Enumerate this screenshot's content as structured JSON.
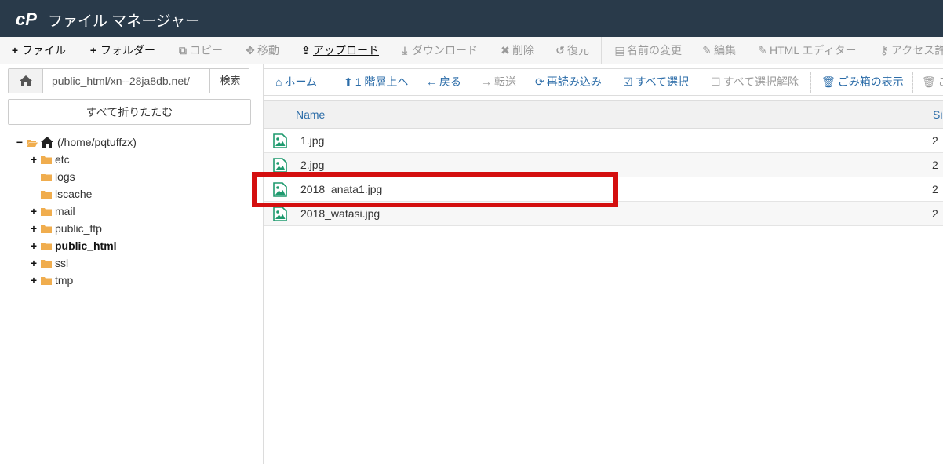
{
  "header": {
    "title": "ファイル マネージャー",
    "logo_icon": "cpanel-logo-icon"
  },
  "toolbar": [
    {
      "icon": "+",
      "label": "ファイル",
      "state": "active"
    },
    {
      "icon": "+",
      "label": "フォルダー",
      "state": "active"
    },
    {
      "icon": "⧉",
      "label": "コピー",
      "state": "disabled"
    },
    {
      "icon": "✥",
      "label": "移動",
      "state": "disabled"
    },
    {
      "icon": "⇪",
      "label": "アップロード",
      "state": "upload"
    },
    {
      "icon": "⤓",
      "label": "ダウンロード",
      "state": "disabled"
    },
    {
      "icon": "✖",
      "label": "削除",
      "state": "disabled"
    },
    {
      "icon": "↺",
      "label": "復元",
      "state": "disabled"
    },
    {
      "icon": "▤",
      "label": "名前の変更",
      "state": "disabled"
    },
    {
      "icon": "✎",
      "label": "編集",
      "state": "disabled"
    },
    {
      "icon": "✎",
      "label": "HTML エディター",
      "state": "disabled"
    },
    {
      "icon": "⚷",
      "label": "アクセス許",
      "state": "disabled"
    }
  ],
  "left": {
    "path_value": "public_html/xn--28ja8db.net/",
    "search_label": "検索",
    "collapse_label": "すべて折りたたむ"
  },
  "tree": [
    {
      "toggle": "−",
      "label": "(/home/pqtuffzx)",
      "bold": false,
      "home": true
    },
    {
      "toggle": "+",
      "label": "etc",
      "bold": false
    },
    {
      "toggle": "",
      "label": "logs",
      "bold": false
    },
    {
      "toggle": "",
      "label": "lscache",
      "bold": false
    },
    {
      "toggle": "+",
      "label": "mail",
      "bold": false
    },
    {
      "toggle": "+",
      "label": "public_ftp",
      "bold": false
    },
    {
      "toggle": "+",
      "label": "public_html",
      "bold": true
    },
    {
      "toggle": "+",
      "label": "ssl",
      "bold": false
    },
    {
      "toggle": "+",
      "label": "tmp",
      "bold": false
    }
  ],
  "nav": [
    {
      "icon": "⌂",
      "label": "ホーム",
      "state": "active"
    },
    {
      "icon": "⬆",
      "label": "1 階層上へ",
      "state": "active"
    },
    {
      "icon": "←",
      "label": "戻る",
      "state": "active"
    },
    {
      "icon": "→",
      "label": "転送",
      "state": "disabled"
    },
    {
      "icon": "⟳",
      "label": "再読み込み",
      "state": "active"
    },
    {
      "icon": "☑",
      "label": "すべて選択",
      "state": "active"
    },
    {
      "icon": "☐",
      "label": "すべて選択解除",
      "state": "disabled"
    },
    {
      "icon": "🗑",
      "label": "ごみ箱の表示",
      "state": "active"
    },
    {
      "icon": "🗑",
      "label": "ご",
      "state": "disabled"
    }
  ],
  "table": {
    "headers": {
      "name": "Name",
      "size": "Si"
    },
    "rows": [
      {
        "name": "1.jpg",
        "size": "2"
      },
      {
        "name": "2.jpg",
        "size": "2"
      },
      {
        "name": "2018_anata1.jpg",
        "size": "2"
      },
      {
        "name": "2018_watasi.jpg",
        "size": "2"
      }
    ]
  },
  "colors": {
    "header_bg": "#293a4a",
    "link": "#2b6ca8",
    "highlight": "#d40f0f",
    "folder": "#f0ad4e",
    "file_icon": "#1e9a6e"
  }
}
